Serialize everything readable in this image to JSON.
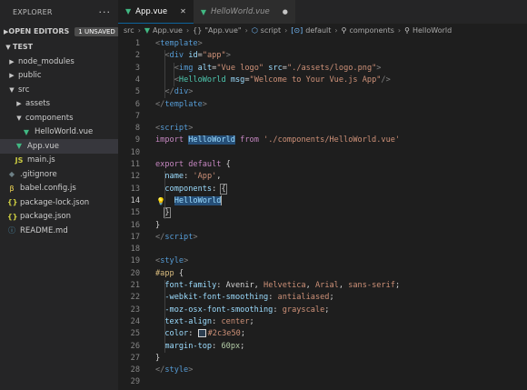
{
  "explorer": {
    "title": "EXPLORER",
    "more": "···",
    "open_editors": {
      "label": "OPEN EDITORS",
      "badge": "1 UNSAVED"
    },
    "folder": "TEST",
    "items": [
      {
        "label": "node_modules",
        "kind": "folder",
        "open": false,
        "indent": 1
      },
      {
        "label": "public",
        "kind": "folder",
        "open": false,
        "indent": 1
      },
      {
        "label": "src",
        "kind": "folder",
        "open": true,
        "indent": 1
      },
      {
        "label": "assets",
        "kind": "folder",
        "open": false,
        "indent": 2
      },
      {
        "label": "components",
        "kind": "folder",
        "open": true,
        "indent": 2
      },
      {
        "label": "HelloWorld.vue",
        "kind": "vue",
        "indent": 3
      },
      {
        "label": "App.vue",
        "kind": "vue",
        "indent": 2,
        "selected": true
      },
      {
        "label": "main.js",
        "kind": "js",
        "indent": 2
      },
      {
        "label": ".gitignore",
        "kind": "git",
        "indent": 1
      },
      {
        "label": "babel.config.js",
        "kind": "babel",
        "indent": 1
      },
      {
        "label": "package-lock.json",
        "kind": "json",
        "indent": 1
      },
      {
        "label": "package.json",
        "kind": "json",
        "indent": 1
      },
      {
        "label": "README.md",
        "kind": "info",
        "indent": 1
      }
    ]
  },
  "tabs": [
    {
      "label": "App.vue",
      "active": true,
      "close": "✕"
    },
    {
      "label": "HelloWorld.vue",
      "active": false,
      "dirty": "●"
    }
  ],
  "breadcrumb": {
    "src": "src",
    "file": "App.vue",
    "braces": "{}",
    "vue_string": "\"App.vue\"",
    "script": "script",
    "default": "default",
    "components": "components",
    "hello": "HelloWorld"
  },
  "editor": {
    "current_line": 14,
    "lines": [
      [
        [
          "t-punc",
          "<"
        ],
        [
          "t-tag",
          "template"
        ],
        [
          "t-punc",
          ">"
        ]
      ],
      [
        [
          "t-txt",
          "  "
        ],
        [
          "t-punc",
          "<"
        ],
        [
          "t-tag",
          "div"
        ],
        [
          "t-txt",
          " "
        ],
        [
          "t-attr",
          "id"
        ],
        [
          "t-txt",
          "="
        ],
        [
          "t-str",
          "\"app\""
        ],
        [
          "t-punc",
          ">"
        ]
      ],
      [
        [
          "t-txt",
          "    "
        ],
        [
          "t-punc",
          "<"
        ],
        [
          "t-tag",
          "img"
        ],
        [
          "t-txt",
          " "
        ],
        [
          "t-attr",
          "alt"
        ],
        [
          "t-txt",
          "="
        ],
        [
          "t-str",
          "\"Vue logo\""
        ],
        [
          "t-txt",
          " "
        ],
        [
          "t-attr",
          "src"
        ],
        [
          "t-txt",
          "="
        ],
        [
          "t-str",
          "\"./assets/logo.png\""
        ],
        [
          "t-punc",
          ">"
        ]
      ],
      [
        [
          "t-txt",
          "    "
        ],
        [
          "t-punc",
          "<"
        ],
        [
          "t-comp",
          "HelloWorld"
        ],
        [
          "t-txt",
          " "
        ],
        [
          "t-attr",
          "msg"
        ],
        [
          "t-txt",
          "="
        ],
        [
          "t-str",
          "\"Welcome to Your Vue.js App\""
        ],
        [
          "t-punc",
          "/>"
        ]
      ],
      [
        [
          "t-txt",
          "  "
        ],
        [
          "t-punc",
          "</"
        ],
        [
          "t-tag",
          "div"
        ],
        [
          "t-punc",
          ">"
        ]
      ],
      [
        [
          "t-punc",
          "</"
        ],
        [
          "t-tag",
          "template"
        ],
        [
          "t-punc",
          ">"
        ]
      ],
      [],
      [
        [
          "t-punc",
          "<"
        ],
        [
          "t-tag",
          "script"
        ],
        [
          "t-punc",
          ">"
        ]
      ],
      [
        [
          "t-kw",
          "import"
        ],
        [
          "t-txt",
          " "
        ],
        [
          "t-var t-hl",
          "HelloWorld"
        ],
        [
          "t-txt",
          " "
        ],
        [
          "t-kw",
          "from"
        ],
        [
          "t-txt",
          " "
        ],
        [
          "t-str",
          "'./components/HelloWorld.vue'"
        ]
      ],
      [],
      [
        [
          "t-kw",
          "export"
        ],
        [
          "t-txt",
          " "
        ],
        [
          "t-kw",
          "default"
        ],
        [
          "t-txt",
          " {"
        ]
      ],
      [
        [
          "t-txt",
          "  "
        ],
        [
          "t-var",
          "name"
        ],
        [
          "t-txt",
          ": "
        ],
        [
          "t-str",
          "'App'"
        ],
        [
          "t-txt",
          ","
        ]
      ],
      [
        [
          "t-txt",
          "  "
        ],
        [
          "t-var",
          "components"
        ],
        [
          "t-txt",
          ": "
        ],
        [
          "t-txt t-bracket",
          "{"
        ]
      ],
      [
        [
          "t-txt",
          "    "
        ],
        [
          "t-var t-hl",
          "HelloWorld"
        ],
        [
          "cursor",
          ""
        ]
      ],
      [
        [
          "t-txt",
          "  "
        ],
        [
          "t-txt t-bracket",
          "}"
        ]
      ],
      [
        [
          "t-txt",
          "}"
        ]
      ],
      [
        [
          "t-punc",
          "</"
        ],
        [
          "t-tag",
          "script"
        ],
        [
          "t-punc",
          ">"
        ]
      ],
      [],
      [
        [
          "t-punc",
          "<"
        ],
        [
          "t-tag",
          "style"
        ],
        [
          "t-punc",
          ">"
        ]
      ],
      [
        [
          "t-sel",
          "#app"
        ],
        [
          "t-txt",
          " {"
        ]
      ],
      [
        [
          "t-txt",
          "  "
        ],
        [
          "t-prop",
          "font-family"
        ],
        [
          "t-txt",
          ": Avenir, "
        ],
        [
          "t-str",
          "Helvetica"
        ],
        [
          "t-txt",
          ", "
        ],
        [
          "t-str",
          "Arial"
        ],
        [
          "t-txt",
          ", "
        ],
        [
          "t-str",
          "sans-serif"
        ],
        [
          "t-txt",
          ";"
        ]
      ],
      [
        [
          "t-txt",
          "  "
        ],
        [
          "t-prop",
          "-webkit-font-smoothing"
        ],
        [
          "t-txt",
          ": "
        ],
        [
          "t-str",
          "antialiased"
        ],
        [
          "t-txt",
          ";"
        ]
      ],
      [
        [
          "t-txt",
          "  "
        ],
        [
          "t-prop",
          "-moz-osx-font-smoothing"
        ],
        [
          "t-txt",
          ": "
        ],
        [
          "t-str",
          "grayscale"
        ],
        [
          "t-txt",
          ";"
        ]
      ],
      [
        [
          "t-txt",
          "  "
        ],
        [
          "t-prop",
          "text-align"
        ],
        [
          "t-txt",
          ": "
        ],
        [
          "t-str",
          "center"
        ],
        [
          "t-txt",
          ";"
        ]
      ],
      [
        [
          "t-txt",
          "  "
        ],
        [
          "t-prop",
          "color"
        ],
        [
          "t-txt",
          ": "
        ],
        [
          "swatch",
          ""
        ],
        [
          "t-str",
          "#2c3e50"
        ],
        [
          "t-txt",
          ";"
        ]
      ],
      [
        [
          "t-txt",
          "  "
        ],
        [
          "t-prop",
          "margin-top"
        ],
        [
          "t-txt",
          ": "
        ],
        [
          "t-num",
          "60px"
        ],
        [
          "t-txt",
          ";"
        ]
      ],
      [
        [
          "t-txt",
          "}"
        ]
      ],
      [
        [
          "t-punc",
          "</"
        ],
        [
          "t-tag",
          "style"
        ],
        [
          "t-punc",
          ">"
        ]
      ],
      []
    ]
  },
  "colors": {
    "accent": "#0e639c",
    "vue": "#41b883",
    "swatch": "#2c3e50"
  },
  "icons": {
    "lightbulb": "lightbulb-icon",
    "vue": "vue-file-icon",
    "close": "close-icon"
  }
}
